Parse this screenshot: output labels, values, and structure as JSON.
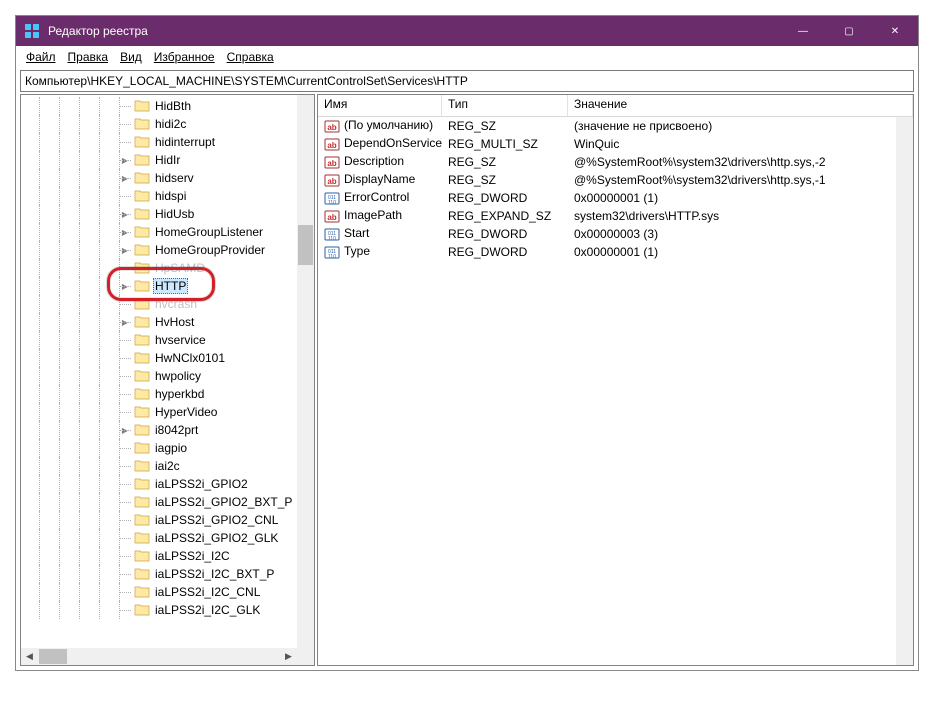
{
  "window": {
    "title": "Редактор реестра",
    "controls": {
      "min": "—",
      "max": "▢",
      "close": "✕"
    }
  },
  "menu": {
    "file": "Файл",
    "edit": "Правка",
    "view": "Вид",
    "favorites": "Избранное",
    "help": "Справка"
  },
  "address": "Компьютер\\HKEY_LOCAL_MACHINE\\SYSTEM\\CurrentControlSet\\Services\\HTTP",
  "tree": {
    "items": [
      {
        "label": "HidBth",
        "exp": "",
        "indent": 4
      },
      {
        "label": "hidi2c",
        "exp": "",
        "indent": 4
      },
      {
        "label": "hidinterrupt",
        "exp": "",
        "indent": 4
      },
      {
        "label": "HidIr",
        "exp": ">",
        "indent": 4
      },
      {
        "label": "hidserv",
        "exp": ">",
        "indent": 4
      },
      {
        "label": "hidspi",
        "exp": "",
        "indent": 4
      },
      {
        "label": "HidUsb",
        "exp": ">",
        "indent": 4
      },
      {
        "label": "HomeGroupListener",
        "exp": ">",
        "indent": 4
      },
      {
        "label": "HomeGroupProvider",
        "exp": ">",
        "indent": 4
      },
      {
        "label": "HpSAMD",
        "exp": "",
        "indent": 4,
        "obscured": true
      },
      {
        "label": "HTTP",
        "exp": ">",
        "indent": 4,
        "selected": true,
        "highlighted": true
      },
      {
        "label": "hvcrash",
        "exp": "",
        "indent": 4,
        "obscured": true
      },
      {
        "label": "HvHost",
        "exp": ">",
        "indent": 4
      },
      {
        "label": "hvservice",
        "exp": "",
        "indent": 4
      },
      {
        "label": "HwNClx0101",
        "exp": "",
        "indent": 4
      },
      {
        "label": "hwpolicy",
        "exp": "",
        "indent": 4
      },
      {
        "label": "hyperkbd",
        "exp": "",
        "indent": 4
      },
      {
        "label": "HyperVideo",
        "exp": "",
        "indent": 4
      },
      {
        "label": "i8042prt",
        "exp": ">",
        "indent": 4
      },
      {
        "label": "iagpio",
        "exp": "",
        "indent": 4
      },
      {
        "label": "iai2c",
        "exp": "",
        "indent": 4
      },
      {
        "label": "iaLPSS2i_GPIO2",
        "exp": "",
        "indent": 4
      },
      {
        "label": "iaLPSS2i_GPIO2_BXT_P",
        "exp": "",
        "indent": 4
      },
      {
        "label": "iaLPSS2i_GPIO2_CNL",
        "exp": "",
        "indent": 4
      },
      {
        "label": "iaLPSS2i_GPIO2_GLK",
        "exp": "",
        "indent": 4
      },
      {
        "label": "iaLPSS2i_I2C",
        "exp": "",
        "indent": 4
      },
      {
        "label": "iaLPSS2i_I2C_BXT_P",
        "exp": "",
        "indent": 4
      },
      {
        "label": "iaLPSS2i_I2C_CNL",
        "exp": "",
        "indent": 4
      },
      {
        "label": "iaLPSS2i_I2C_GLK",
        "exp": "",
        "indent": 4
      }
    ]
  },
  "list": {
    "columns": {
      "name": "Имя",
      "type": "Тип",
      "value": "Значение"
    },
    "rows": [
      {
        "icon": "str",
        "name": "(По умолчанию)",
        "type": "REG_SZ",
        "value": "(значение не присвоено)"
      },
      {
        "icon": "str",
        "name": "DependOnService",
        "type": "REG_MULTI_SZ",
        "value": "WinQuic"
      },
      {
        "icon": "str",
        "name": "Description",
        "type": "REG_SZ",
        "value": "@%SystemRoot%\\system32\\drivers\\http.sys,-2"
      },
      {
        "icon": "str",
        "name": "DisplayName",
        "type": "REG_SZ",
        "value": "@%SystemRoot%\\system32\\drivers\\http.sys,-1"
      },
      {
        "icon": "bin",
        "name": "ErrorControl",
        "type": "REG_DWORD",
        "value": "0x00000001 (1)"
      },
      {
        "icon": "str",
        "name": "ImagePath",
        "type": "REG_EXPAND_SZ",
        "value": "system32\\drivers\\HTTP.sys"
      },
      {
        "icon": "bin",
        "name": "Start",
        "type": "REG_DWORD",
        "value": "0x00000003 (3)"
      },
      {
        "icon": "bin",
        "name": "Type",
        "type": "REG_DWORD",
        "value": "0x00000001 (1)"
      }
    ]
  }
}
